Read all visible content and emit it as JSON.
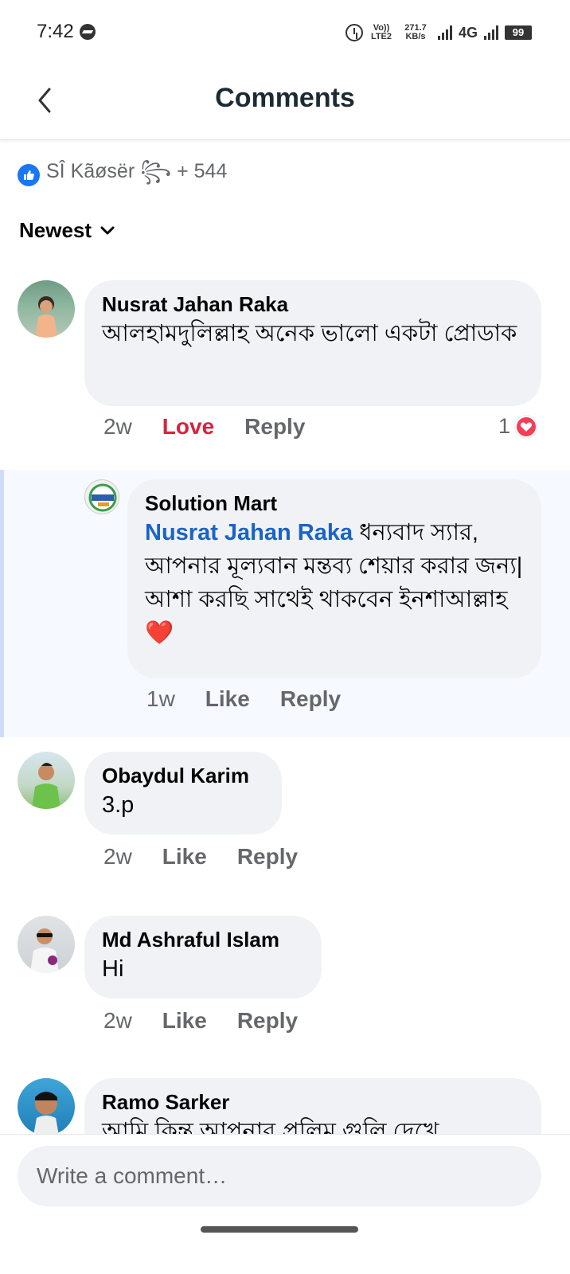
{
  "status_bar": {
    "time": "7:42",
    "volte": "Vo)) LTE2",
    "speed": "271.7 KB/s",
    "network": "4G",
    "battery": "99"
  },
  "header": {
    "title": "Comments",
    "back_icon": "chevron-left-icon"
  },
  "reactions": {
    "summary": "SÎ Kãøsër ꧂ + 544",
    "icon": "like-icon",
    "accent": "#1877f2"
  },
  "sort": {
    "label": "Newest",
    "icon": "chevron-down-icon"
  },
  "comments": [
    {
      "author": "Nusrat Jahan Raka",
      "text": "আলহামদুলিল্লাহ অনেক ভালো একটা প্রোডাক",
      "time": "2w",
      "like_label": "Love",
      "reply_label": "Reply",
      "reaction_count": "1",
      "reaction_icon": "love-icon",
      "reply": {
        "author": "Solution Mart",
        "mention": "Nusrat Jahan Raka",
        "text": "ধন্যবাদ স্যার, আপনার মূল্যবান মন্তব্য শেয়ার করার জন্য| আশা করছি সাথেই থাকবেন ইনশাআল্লাহ❤️",
        "time": "1w",
        "like_label": "Like",
        "reply_label": "Reply"
      }
    },
    {
      "author": "Obaydul Karim",
      "text": "3.p",
      "time": "2w",
      "like_label": "Like",
      "reply_label": "Reply"
    },
    {
      "author": "Md Ashraful Islam",
      "text": "Hi",
      "time": "2w",
      "like_label": "Like",
      "reply_label": "Reply"
    },
    {
      "author": "Ramo Sarker",
      "text": "আমি কিন্তু আপনার প্রলিম গুলি দেখে"
    }
  ],
  "composer": {
    "placeholder": "Write a comment…"
  },
  "colors": {
    "love": "#d4233f",
    "mention": "#1b63c4",
    "bubble": "#f0f2f5"
  }
}
